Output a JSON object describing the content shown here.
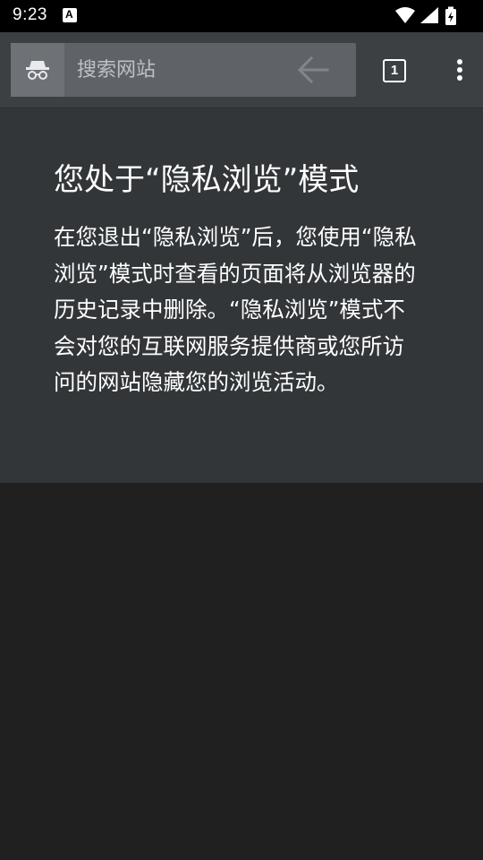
{
  "status_bar": {
    "time": "9:23",
    "icons": [
      "notification-a-icon",
      "wifi-icon",
      "signal-icon",
      "battery-charging-icon"
    ]
  },
  "toolbar": {
    "incognito_icon": "incognito-icon",
    "search_placeholder": "搜索网站",
    "back_icon": "back-arrow-icon",
    "tab_count": "1",
    "menu_icon": "more-vert-icon"
  },
  "incognito_page": {
    "title": "您处于“隐私浏览”模式",
    "description": "在您退出“隐私浏览”后，您使用“隐私浏览”模式时查看的页面将从浏览器的历史记录中删除。“隐私浏览”模式不会对您的互联网服务提供商或您所访问的网站隐藏您的浏览活动。"
  },
  "colors": {
    "status_bar": "#000000",
    "toolbar": "#3c4043",
    "omnibox": "#5f6368",
    "content_panel": "#323639",
    "background": "#202020",
    "text": "#ffffff"
  }
}
